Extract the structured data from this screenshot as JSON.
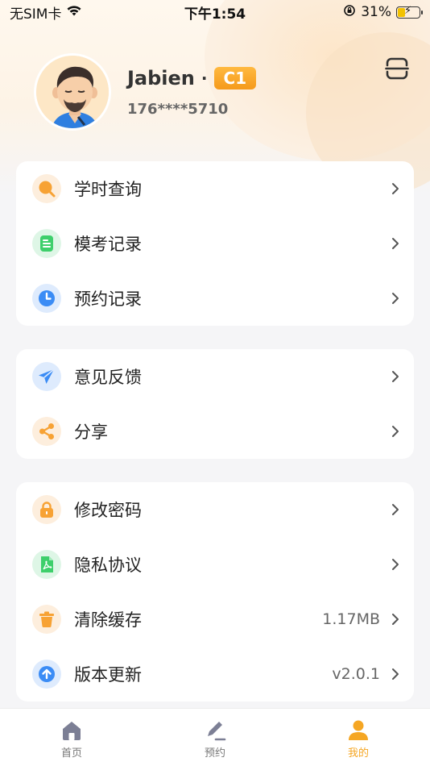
{
  "status_bar": {
    "carrier": "无SIM卡",
    "time": "下午1:54",
    "battery_percent": "31%"
  },
  "profile": {
    "name": "Jabien",
    "separator": "·",
    "license_badge": "C1",
    "phone": "176****5710"
  },
  "menu_groups": [
    {
      "items": [
        {
          "label": "学时查询",
          "icon": "search-icon",
          "color": "#f7a234"
        },
        {
          "label": "模考记录",
          "icon": "document-icon",
          "color": "#3ecf6b"
        },
        {
          "label": "预约记录",
          "icon": "clock-icon",
          "color": "#3b8cf5"
        }
      ]
    },
    {
      "items": [
        {
          "label": "意见反馈",
          "icon": "paper-plane-icon",
          "color": "#3b8cf5"
        },
        {
          "label": "分享",
          "icon": "share-icon",
          "color": "#f7a234"
        }
      ]
    },
    {
      "items": [
        {
          "label": "修改密码",
          "icon": "lock-icon",
          "color": "#f7a234"
        },
        {
          "label": "隐私协议",
          "icon": "pdf-document-icon",
          "color": "#3ecf6b"
        },
        {
          "label": "清除缓存",
          "value": "1.17MB",
          "icon": "trash-icon",
          "color": "#f7a234"
        },
        {
          "label": "版本更新",
          "value": "v2.0.1",
          "icon": "upload-icon",
          "color": "#3b8cf5"
        }
      ]
    }
  ],
  "tab_bar": {
    "tabs": [
      {
        "label": "首页",
        "icon": "home-icon",
        "active": false
      },
      {
        "label": "预约",
        "icon": "pen-icon",
        "active": false
      },
      {
        "label": "我的",
        "icon": "person-icon",
        "active": true
      }
    ]
  },
  "colors": {
    "accent": "#f5a623",
    "badge": "#f7a234"
  }
}
